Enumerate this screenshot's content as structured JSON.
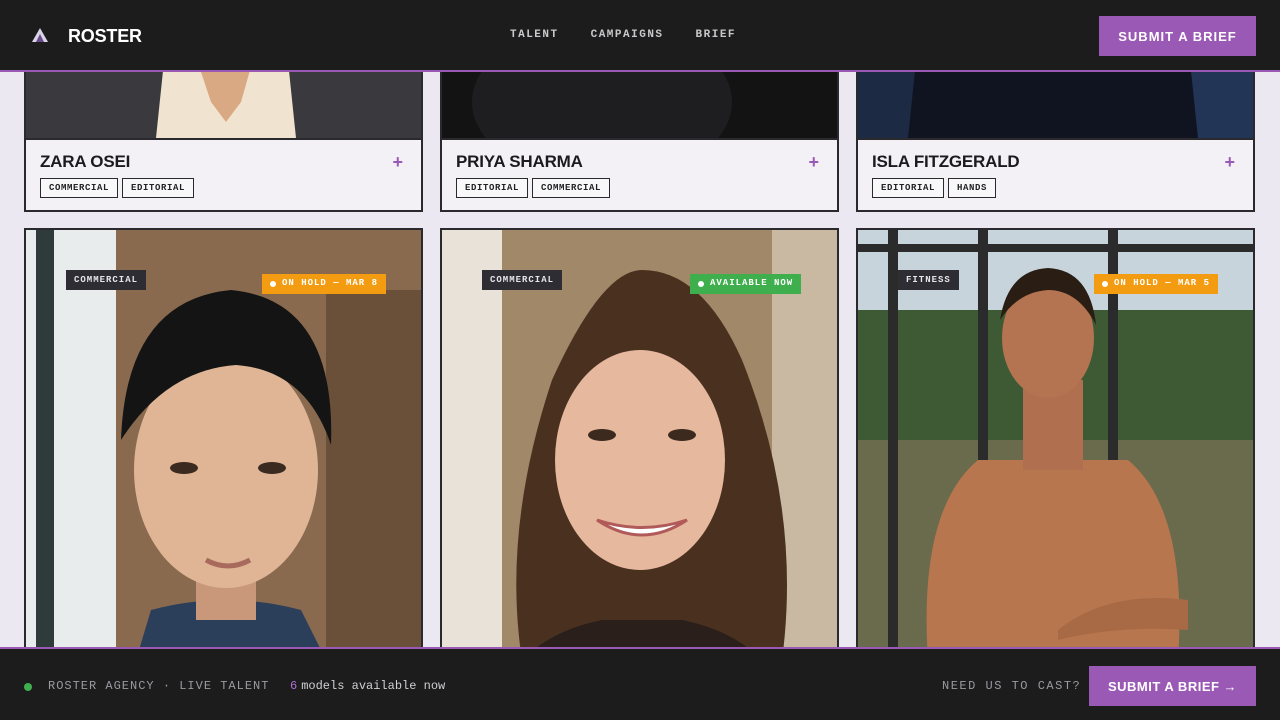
{
  "header": {
    "brand": "ROSTER",
    "nav": [
      "TALENT",
      "CAMPAIGNS",
      "BRIEF"
    ],
    "cta": "SUBMIT A BRIEF"
  },
  "top_cards": [
    {
      "name": "ZARA OSEI",
      "plus": "+",
      "tags": [
        "COMMERCIAL",
        "EDITORIAL"
      ]
    },
    {
      "name": "PRIYA SHARMA",
      "plus": "+",
      "tags": [
        "EDITORIAL",
        "COMMERCIAL"
      ]
    },
    {
      "name": "ISLA FITZGERALD",
      "plus": "+",
      "tags": [
        "EDITORIAL",
        "HANDS"
      ]
    }
  ],
  "photo_cards": [
    {
      "category": "COMMERCIAL",
      "status": "ON HOLD — MAR 8",
      "status_type": "hold"
    },
    {
      "category": "COMMERCIAL",
      "status": "AVAILABLE NOW",
      "status_type": "available"
    },
    {
      "category": "FITNESS",
      "status": "ON HOLD — MAR 5",
      "status_type": "hold"
    }
  ],
  "footer": {
    "agency": "ROSTER AGENCY · LIVE TALENT",
    "count": "6",
    "count_label": "models available now",
    "need": "NEED US TO CAST?",
    "cta": "SUBMIT A BRIEF →"
  },
  "colors": {
    "accent": "#9b59b6",
    "hold": "#f39c12",
    "available": "#3fae4c",
    "dark": "#1c1c1d"
  }
}
